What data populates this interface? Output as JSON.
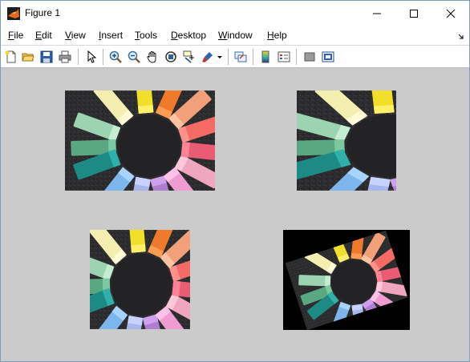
{
  "window": {
    "title": "Figure 1",
    "controls": [
      "minimize",
      "maximize",
      "close"
    ]
  },
  "menu": {
    "items": [
      {
        "label": "File",
        "mnemonic": "F",
        "rest": "ile"
      },
      {
        "label": "Edit",
        "mnemonic": "E",
        "rest": "dit"
      },
      {
        "label": "View",
        "mnemonic": "V",
        "rest": "iew"
      },
      {
        "label": "Insert",
        "mnemonic": "I",
        "rest": "nsert"
      },
      {
        "label": "Tools",
        "mnemonic": "T",
        "rest": "ools"
      },
      {
        "label": "Desktop",
        "mnemonic": "D",
        "rest": "esktop"
      },
      {
        "label": "Window",
        "mnemonic": "W",
        "rest": "indow"
      },
      {
        "label": "Help",
        "mnemonic": "H",
        "rest": "elp"
      }
    ]
  },
  "toolbar": {
    "buttons": [
      "new-figure",
      "open-file",
      "save-figure",
      "print-figure",
      "edit-plot",
      "zoom-in",
      "zoom-out",
      "pan",
      "rotate-3d",
      "data-cursor",
      "brush",
      "link-plot",
      "insert-colorbar",
      "insert-legend",
      "hide-plot-tools",
      "show-plot-tools"
    ]
  },
  "figure": {
    "background": "#cbcbcb",
    "images": [
      {
        "id": "original",
        "description": "chalk circle photo"
      },
      {
        "id": "cropped",
        "description": "cropped chalk photo"
      },
      {
        "id": "resized",
        "description": "resized chalk photo"
      },
      {
        "id": "rotated",
        "description": "rotated chalk photo"
      }
    ]
  }
}
